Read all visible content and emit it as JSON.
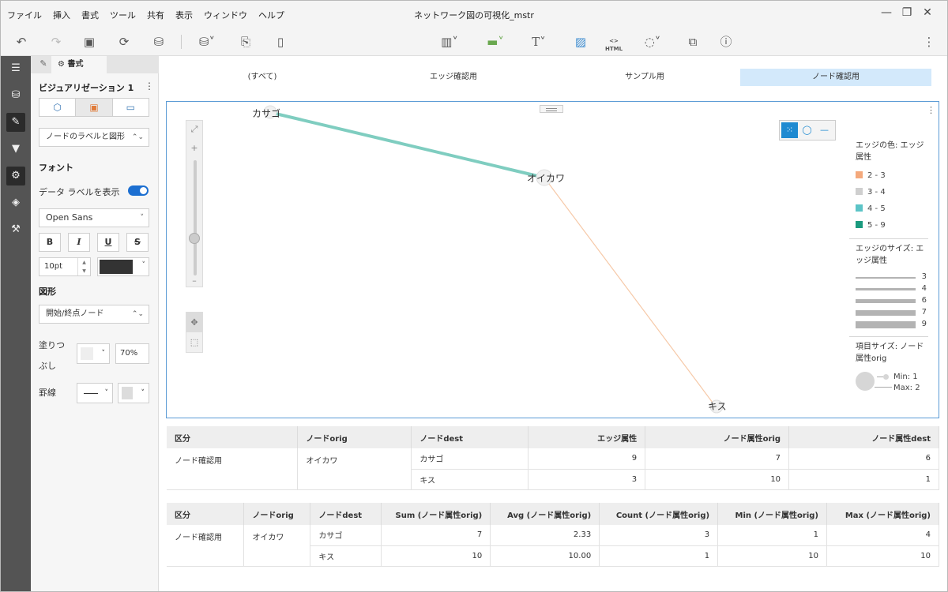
{
  "window": {
    "title": "ネットワーク図の可視化_mstr",
    "menu": [
      "ファイル",
      "挿入",
      "書式",
      "ツール",
      "共有",
      "表示",
      "ウィンドウ",
      "ヘルプ"
    ],
    "controls": [
      "—",
      "❐",
      "✕"
    ]
  },
  "toolbar": {
    "icons": [
      "undo-icon",
      "redo-icon",
      "save-icon",
      "refresh-icon",
      "data-source-icon",
      "add-data-icon",
      "duplicate-page-icon",
      "new-page-icon",
      "insert-visualization-icon",
      "filter-selector-icon",
      "text-icon",
      "image-icon",
      "html-icon",
      "shape-icon",
      "panel-stack-icon",
      "info-icon",
      "more-icon"
    ],
    "text_label": "T",
    "html_label": "HTML"
  },
  "panel": {
    "tab_label": "書式",
    "vis_title": "ビジュアリゼーション 1",
    "target_select": "ノードのラベルと図形",
    "font_section": "フォント",
    "show_labels": "データ ラベルを表示",
    "font_family": "Open Sans",
    "format_buttons": [
      "B",
      "I",
      "U",
      "S"
    ],
    "font_size": "10pt",
    "font_color": "#333333",
    "shape_section": "図形",
    "shape_select": "開始/終点ノード",
    "fill_label_1": "塗りつ",
    "fill_label_2": "ぶし",
    "fill_opacity": "70%",
    "border_label": "罫線"
  },
  "tabs": {
    "items": [
      "(すべて)",
      "エッジ確認用",
      "サンプル用",
      "ノード確認用"
    ],
    "selected": "ノード確認用"
  },
  "network": {
    "nodes": [
      "カサゴ",
      "オイカワ",
      "キス"
    ],
    "edges": [
      {
        "from": "オイカワ",
        "to": "カサゴ",
        "edge_attr": 9,
        "color": "#7fcdc0"
      },
      {
        "from": "オイカワ",
        "to": "キス",
        "edge_attr": 3,
        "color": "#f6c9a8"
      }
    ]
  },
  "legend": {
    "color_title": "エッジの色: エッジ属性",
    "color_items": [
      {
        "label": "2 - 3",
        "color": "#f4a97c"
      },
      {
        "label": "3 - 4",
        "color": "#cfcfcf"
      },
      {
        "label": "4 - 5",
        "color": "#5cc4c7"
      },
      {
        "label": "5 - 9",
        "color": "#1a9a7e"
      }
    ],
    "size_title": "エッジのサイズ: エッジ属性",
    "size_items": [
      "3",
      "4",
      "6",
      "7",
      "9"
    ],
    "node_title": "項目サイズ: ノード属性orig",
    "node_min": "Min: 1",
    "node_max": "Max: 2"
  },
  "table1": {
    "headers": [
      "区分",
      "ノードorig",
      "ノードdest",
      "エッジ属性",
      "ノード属性orig",
      "ノード属性dest"
    ],
    "category": "ノード確認用",
    "orig": "オイカワ",
    "rows": [
      {
        "dest": "カサゴ",
        "edge": "9",
        "orig_attr": "7",
        "dest_attr": "6"
      },
      {
        "dest": "キス",
        "edge": "3",
        "orig_attr": "10",
        "dest_attr": "1"
      }
    ]
  },
  "table2": {
    "headers": [
      "区分",
      "ノードorig",
      "ノードdest",
      "Sum (ノード属性orig)",
      "Avg (ノード属性orig)",
      "Count (ノード属性orig)",
      "Min (ノード属性orig)",
      "Max (ノード属性orig)"
    ],
    "category": "ノード確認用",
    "orig": "オイカワ",
    "rows": [
      {
        "dest": "カサゴ",
        "sum": "7",
        "avg": "2.33",
        "count": "3",
        "min": "1",
        "max": "4"
      },
      {
        "dest": "キス",
        "sum": "10",
        "avg": "10.00",
        "count": "1",
        "min": "10",
        "max": "10"
      }
    ]
  }
}
